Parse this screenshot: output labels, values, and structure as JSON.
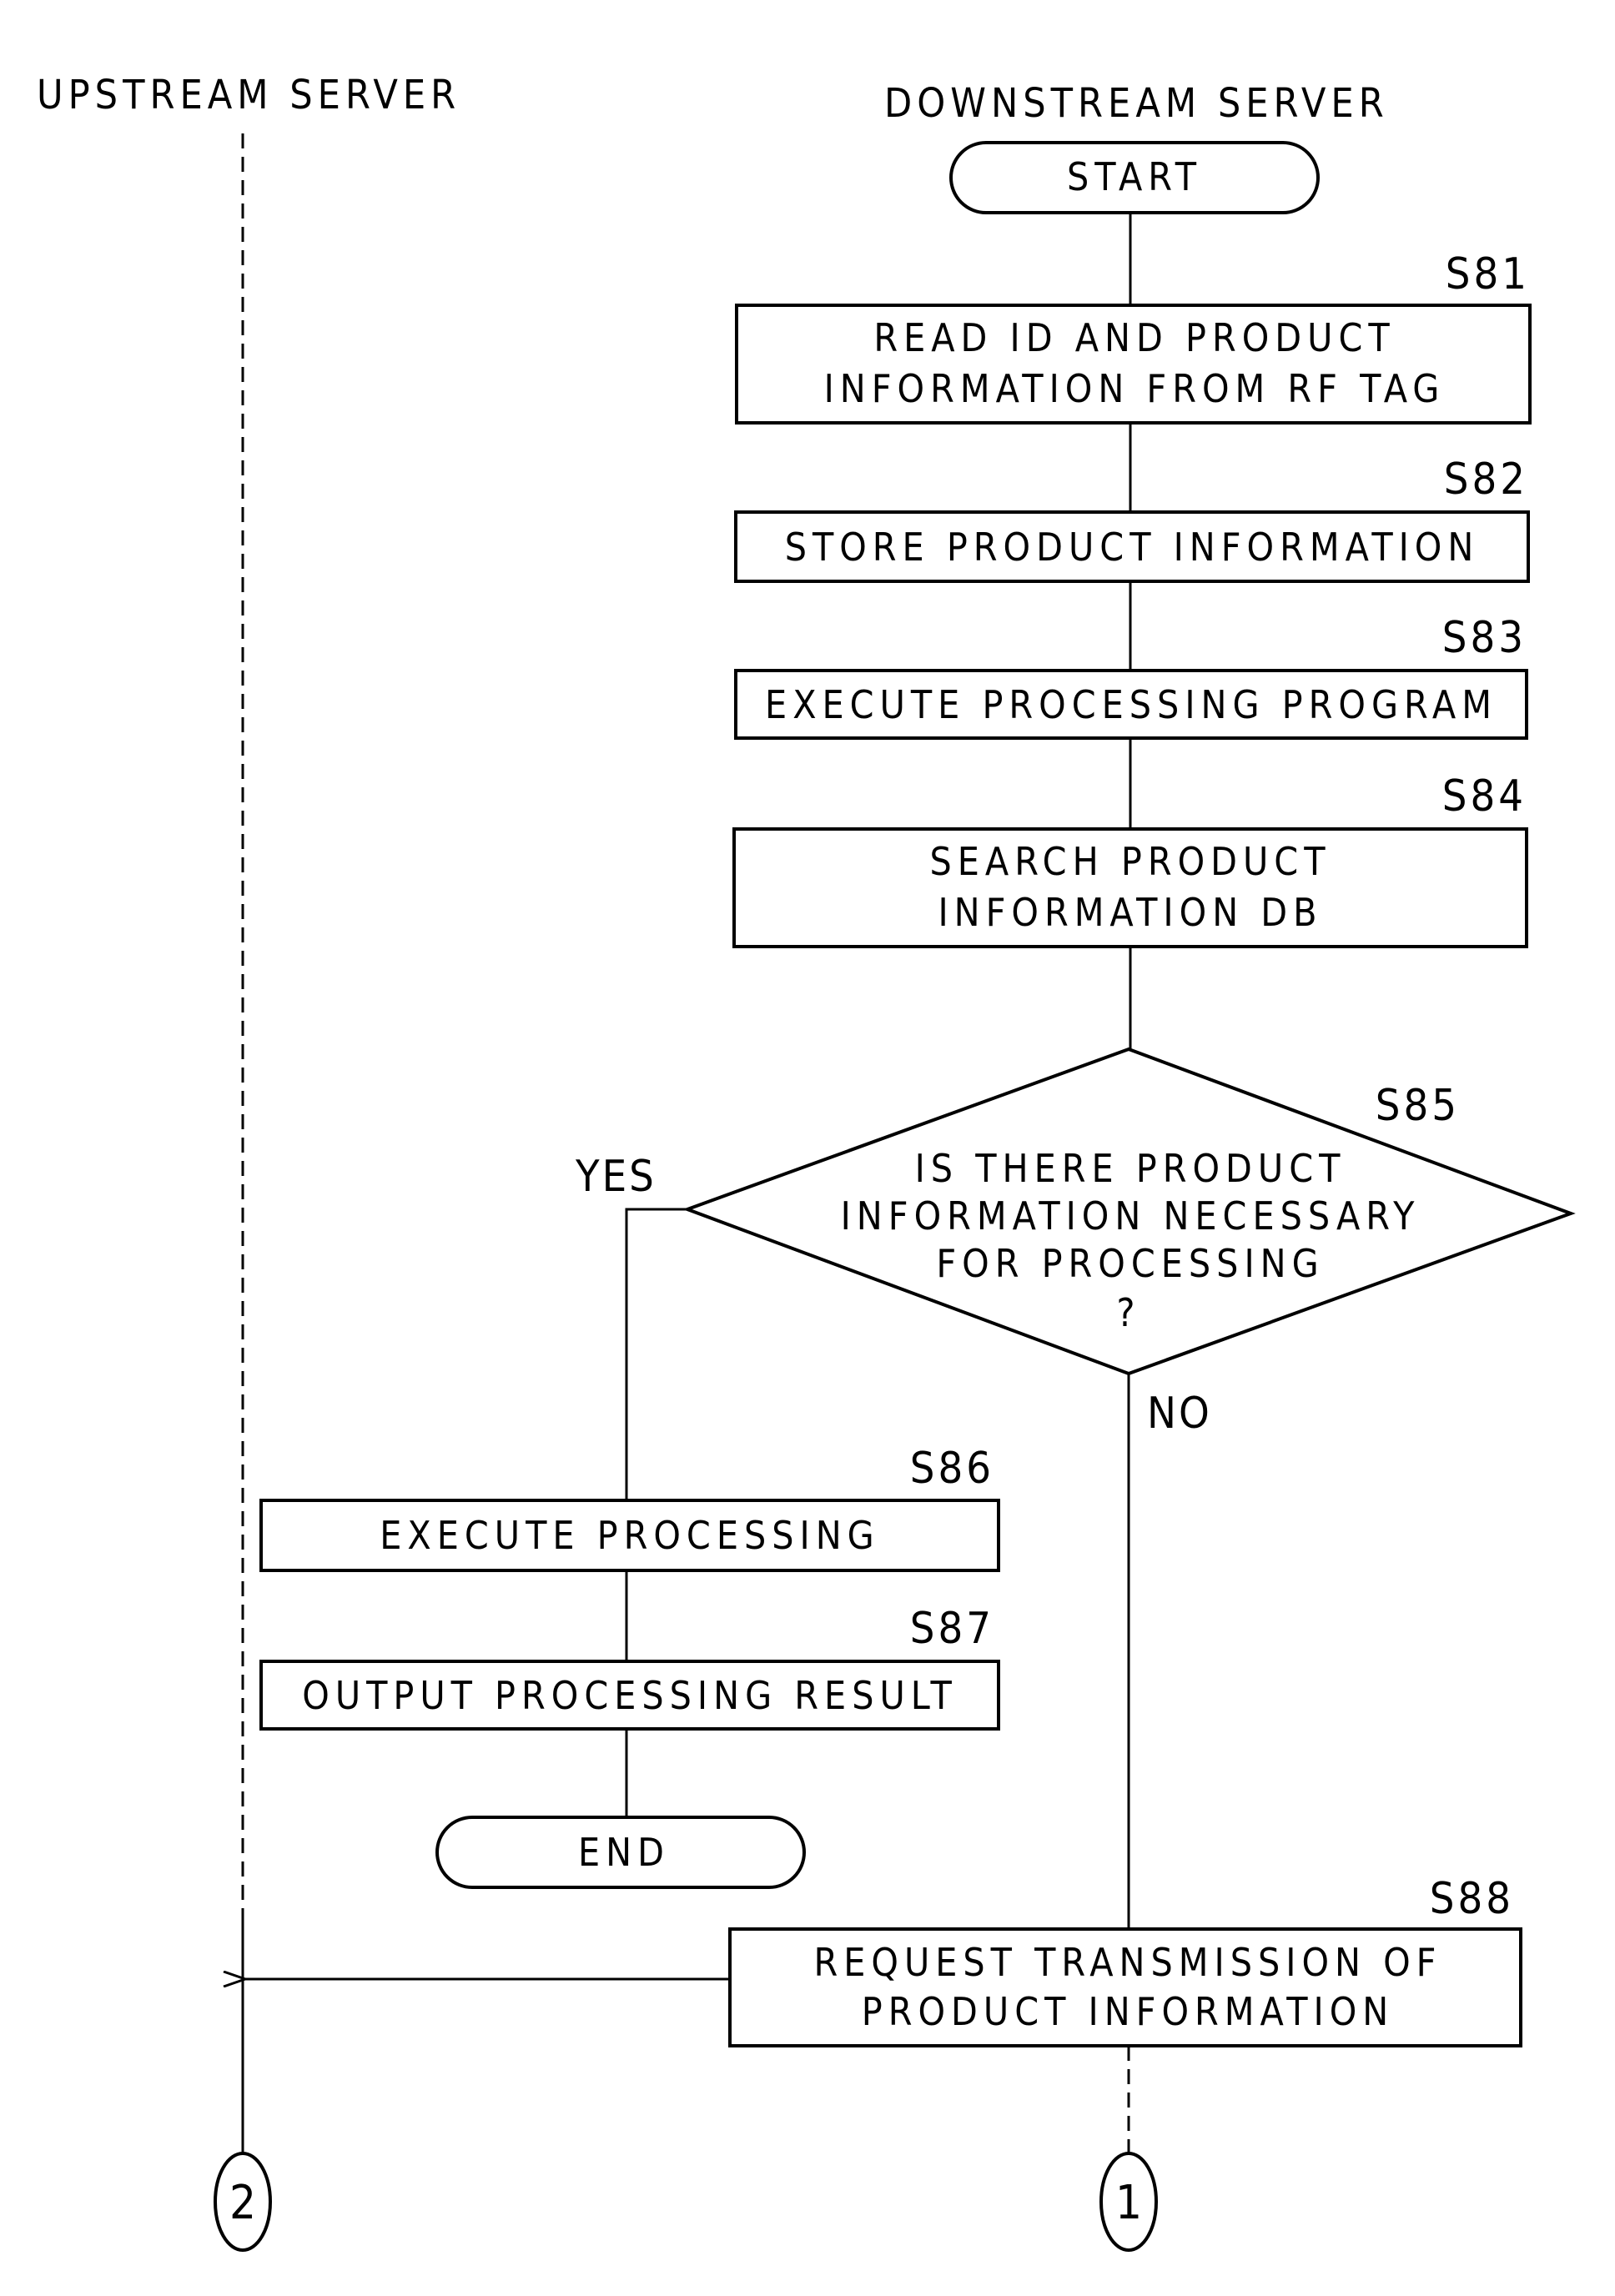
{
  "lanes": {
    "upstream": "UPSTREAM SERVER",
    "downstream": "DOWNSTREAM SERVER"
  },
  "terminals": {
    "start": "START",
    "end": "END"
  },
  "steps": {
    "s81": {
      "id": "S81",
      "lines": [
        "READ ID AND PRODUCT",
        "INFORMATION FROM RF TAG"
      ]
    },
    "s82": {
      "id": "S82",
      "lines": [
        "STORE PRODUCT INFORMATION"
      ]
    },
    "s83": {
      "id": "S83",
      "lines": [
        "EXECUTE PROCESSING PROGRAM"
      ]
    },
    "s84": {
      "id": "S84",
      "lines": [
        "SEARCH PRODUCT",
        "INFORMATION DB"
      ]
    },
    "s85": {
      "id": "S85",
      "lines": [
        "IS THERE PRODUCT",
        "INFORMATION NECESSARY",
        "FOR PROCESSING",
        "?"
      ]
    },
    "s86": {
      "id": "S86",
      "lines": [
        "EXECUTE PROCESSING"
      ]
    },
    "s87": {
      "id": "S87",
      "lines": [
        "OUTPUT PROCESSING RESULT"
      ]
    },
    "s88": {
      "id": "S88",
      "lines": [
        "REQUEST TRANSMISSION OF",
        "PRODUCT INFORMATION"
      ]
    }
  },
  "branches": {
    "yes": "YES",
    "no": "NO"
  },
  "connectors": {
    "c1": "1",
    "c2": "2"
  }
}
